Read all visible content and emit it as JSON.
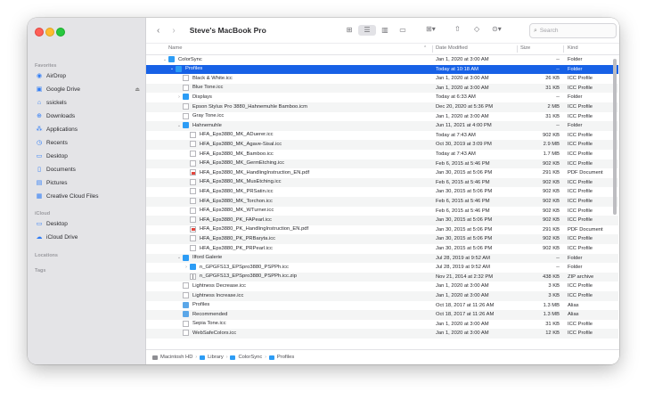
{
  "window": {
    "title": "Steve's MacBook Pro"
  },
  "sidebar": {
    "favorites_label": "Favorites",
    "favorites": [
      {
        "label": "AirDrop",
        "icon": "airdrop-icon"
      },
      {
        "label": "Google Drive",
        "icon": "google-drive-icon"
      },
      {
        "label": "ssickels",
        "icon": "home-icon"
      },
      {
        "label": "Downloads",
        "icon": "downloads-icon"
      },
      {
        "label": "Applications",
        "icon": "applications-icon"
      },
      {
        "label": "Recents",
        "icon": "recents-icon"
      },
      {
        "label": "Desktop",
        "icon": "desktop-icon"
      },
      {
        "label": "Documents",
        "icon": "documents-icon"
      },
      {
        "label": "Pictures",
        "icon": "pictures-icon"
      },
      {
        "label": "Creative Cloud Files",
        "icon": "creative-cloud-icon"
      }
    ],
    "icloud_label": "iCloud",
    "icloud": [
      {
        "label": "Desktop",
        "icon": "desktop-icon"
      },
      {
        "label": "iCloud Drive",
        "icon": "icloud-icon"
      }
    ],
    "locations_label": "Locations",
    "tags_label": "Tags"
  },
  "toolbar": {
    "back": "‹",
    "forward": "›",
    "search_placeholder": "Search"
  },
  "columns": {
    "name": "Name",
    "date": "Date Modified",
    "size": "Size",
    "kind": "Kind"
  },
  "rows": [
    {
      "name": "ColorSync",
      "date": "Jan 1, 2020 at 3:00 AM",
      "size": "--",
      "kind": "Folder"
    },
    {
      "name": "Profiles",
      "date": "Today at 10:18 AM",
      "size": "--",
      "kind": "Folder"
    },
    {
      "name": "Black & White.icc",
      "date": "Jan 1, 2020 at 3:00 AM",
      "size": "26 KB",
      "kind": "ICC Profile"
    },
    {
      "name": "Blue Tone.icc",
      "date": "Jan 1, 2020 at 3:00 AM",
      "size": "31 KB",
      "kind": "ICC Profile"
    },
    {
      "name": "Displays",
      "date": "Today at 6:33 AM",
      "size": "--",
      "kind": "Folder"
    },
    {
      "name": "Epson Stylus Pro 3880_Hahnemuhle Bamboo.icm",
      "date": "Dec 20, 2020 at 5:36 PM",
      "size": "2 MB",
      "kind": "ICC Profile"
    },
    {
      "name": "Gray Tone.icc",
      "date": "Jan 1, 2020 at 3:00 AM",
      "size": "31 KB",
      "kind": "ICC Profile"
    },
    {
      "name": "Hahnemuhle",
      "date": "Jun 11, 2021 at 4:00 PM",
      "size": "--",
      "kind": "Folder"
    },
    {
      "name": "HFA_Eps3880_MK_ADuerer.icc",
      "date": "Today at 7:43 AM",
      "size": "902 KB",
      "kind": "ICC Profile"
    },
    {
      "name": "HFA_Eps3880_MK_Agave-Sisal.icc",
      "date": "Oct 30, 2019 at 3:09 PM",
      "size": "2.9 MB",
      "kind": "ICC Profile"
    },
    {
      "name": "HFA_Eps3880_MK_Bamboo.icc",
      "date": "Today at 7:43 AM",
      "size": "1.7 MB",
      "kind": "ICC Profile"
    },
    {
      "name": "HFA_Eps3880_MK_GermEtching.icc",
      "date": "Feb 6, 2015 at 5:46 PM",
      "size": "902 KB",
      "kind": "ICC Profile"
    },
    {
      "name": "HFA_Eps3880_MK_HandlingInstruction_EN.pdf",
      "date": "Jan 30, 2015 at 5:06 PM",
      "size": "291 KB",
      "kind": "PDF Document"
    },
    {
      "name": "HFA_Eps3880_MK_MusEtching.icc",
      "date": "Feb 6, 2015 at 5:46 PM",
      "size": "902 KB",
      "kind": "ICC Profile"
    },
    {
      "name": "HFA_Eps3880_MK_PRSatin.icc",
      "date": "Jan 30, 2015 at 5:06 PM",
      "size": "902 KB",
      "kind": "ICC Profile"
    },
    {
      "name": "HFA_Eps3880_MK_Torchon.icc",
      "date": "Feb 6, 2015 at 5:46 PM",
      "size": "902 KB",
      "kind": "ICC Profile"
    },
    {
      "name": "HFA_Eps3880_MK_WTurner.icc",
      "date": "Feb 6, 2015 at 5:46 PM",
      "size": "902 KB",
      "kind": "ICC Profile"
    },
    {
      "name": "HFA_Eps3880_PK_FAPearl.icc",
      "date": "Jan 30, 2015 at 5:06 PM",
      "size": "902 KB",
      "kind": "ICC Profile"
    },
    {
      "name": "HFA_Eps3880_PK_HandlingInstruction_EN.pdf",
      "date": "Jan 30, 2015 at 5:06 PM",
      "size": "291 KB",
      "kind": "PDF Document"
    },
    {
      "name": "HFA_Eps3880_PK_PRBaryta.icc",
      "date": "Jan 30, 2015 at 5:06 PM",
      "size": "902 KB",
      "kind": "ICC Profile"
    },
    {
      "name": "HFA_Eps3880_PK_PRPearl.icc",
      "date": "Jan 30, 2015 at 5:06 PM",
      "size": "902 KB",
      "kind": "ICC Profile"
    },
    {
      "name": "Ilford Galerie",
      "date": "Jul 28, 2019 at 9:52 AM",
      "size": "--",
      "kind": "Folder"
    },
    {
      "name": "n_GPGFS13_EPSpro3880_PSPPh.icc",
      "date": "Jul 28, 2019 at 9:52 AM",
      "size": "--",
      "kind": "Folder"
    },
    {
      "name": "n_GPGFS13_EPSpro3880_PSPPh.icc.zip",
      "date": "Nov 21, 2014 at 2:32 PM",
      "size": "438 KB",
      "kind": "ZIP archive"
    },
    {
      "name": "Lightness Decrease.icc",
      "date": "Jan 1, 2020 at 3:00 AM",
      "size": "3 KB",
      "kind": "ICC Profile"
    },
    {
      "name": "Lightness Increase.icc",
      "date": "Jan 1, 2020 at 3:00 AM",
      "size": "3 KB",
      "kind": "ICC Profile"
    },
    {
      "name": "Profiles",
      "date": "Oct 18, 2017 at 11:26 AM",
      "size": "1.3 MB",
      "kind": "Alias"
    },
    {
      "name": "Recommended",
      "date": "Oct 18, 2017 at 11:26 AM",
      "size": "1.3 MB",
      "kind": "Alias"
    },
    {
      "name": "Sepia Tone.icc",
      "date": "Jan 1, 2020 at 3:00 AM",
      "size": "31 KB",
      "kind": "ICC Profile"
    },
    {
      "name": "WebSafeColors.icc",
      "date": "Jan 1, 2020 at 3:00 AM",
      "size": "12 KB",
      "kind": "ICC Profile"
    }
  ],
  "pathbar": [
    "Macintosh HD",
    "Library",
    "ColorSync",
    "Profiles"
  ],
  "colors": {
    "selection": "#1761e6",
    "folder": "#2c9cf5",
    "accent": "#2f7cf6"
  }
}
